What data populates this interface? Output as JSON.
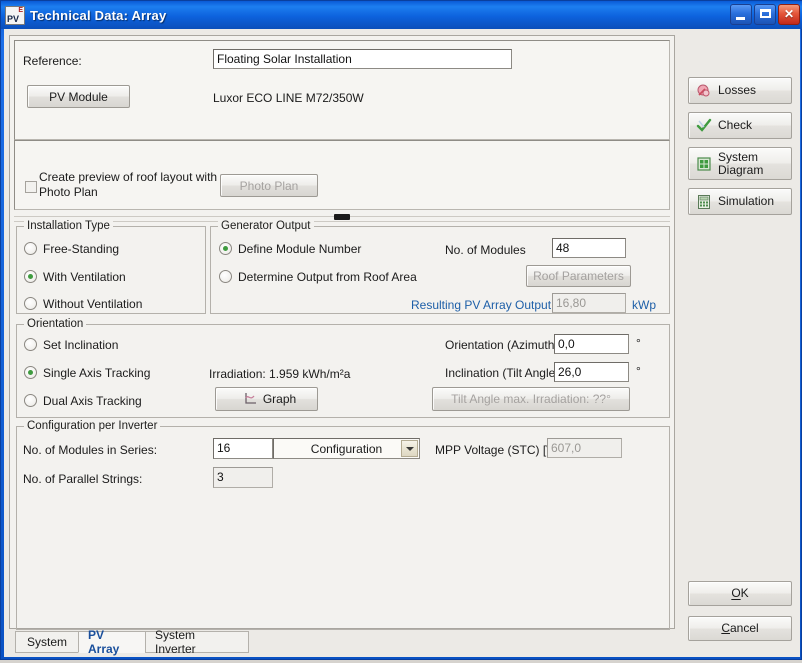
{
  "window": {
    "title": "Technical Data: Array",
    "app_icon": "pv-logo-icon",
    "minimize_label": "Minimize",
    "maximize_label": "Maximize",
    "close_label": "Close",
    "titlebar_color": "#0d62dd",
    "accent_color": "#1a4f9c"
  },
  "form": {
    "reference_label": "Reference:",
    "reference_value": "Floating Solar Installation",
    "pv_module_button": "PV Module",
    "pv_module_value": "Luxor ECO LINE M72/350W",
    "photo_plan_checkbox_label_line1": "Create preview of roof layout with",
    "photo_plan_checkbox_label_line2": "Photo Plan",
    "photo_plan_button": "Photo Plan",
    "photo_plan_checked": false,
    "photo_plan_enabled": false
  },
  "installation_type": {
    "legend": "Installation Type",
    "options": [
      {
        "label": "Free-Standing",
        "selected": false
      },
      {
        "label": "With Ventilation",
        "selected": true
      },
      {
        "label": "Without Ventilation",
        "selected": false
      }
    ]
  },
  "generator_output": {
    "legend": "Generator Output",
    "options": [
      {
        "label": "Define Module Number",
        "selected": true
      },
      {
        "label": "Determine Output from Roof Area",
        "selected": false
      }
    ],
    "modules_label": "No. of Modules",
    "modules_value": "48",
    "roof_parameters_button": "Roof Parameters",
    "roof_parameters_enabled": false,
    "result_label": "Resulting PV Array Output",
    "result_value": "16,80",
    "result_unit": "kWp"
  },
  "orientation": {
    "legend": "Orientation",
    "options": [
      {
        "label": "Set Inclination",
        "selected": false
      },
      {
        "label": "Single Axis Tracking",
        "selected": true
      },
      {
        "label": "Dual Axis Tracking",
        "selected": false
      }
    ],
    "irradiation_text": "Irradiation: 1.959 kWh/m²a",
    "graph_button": "Graph",
    "azimuth_label": "Orientation (Azimuth)",
    "azimuth_value": "0,0",
    "azimuth_unit": "°",
    "tilt_label": "Inclination (Tilt Angle)",
    "tilt_value": "26,0",
    "tilt_unit": "°",
    "tilt_max_button": "Tilt Angle max. Irradiation: ??°"
  },
  "configuration": {
    "legend": "Configuration per Inverter",
    "series_label": "No. of Modules in Series:",
    "series_value": "16",
    "combo_label": "Configuration",
    "strings_label": "No. of Parallel Strings:",
    "strings_value": "3",
    "mpp_label": "MPP Voltage (STC) [V]:",
    "mpp_value": "607,0",
    "mpp_enabled": false
  },
  "sidebar": {
    "items": [
      {
        "label": "Losses",
        "icon": "losses-icon"
      },
      {
        "label": "Check",
        "icon": "check-icon"
      },
      {
        "label": "System\nDiagram",
        "label_line1": "System",
        "label_line2": "Diagram",
        "icon": "system-diagram-icon"
      },
      {
        "label": "Simulation",
        "icon": "simulation-calculator-icon"
      }
    ],
    "ok_button": "OK",
    "ok_accel": "O",
    "cancel_button": "Cancel",
    "cancel_accel": "C"
  },
  "tabs": [
    {
      "label": "System",
      "active": false
    },
    {
      "label": "PV Array",
      "active": true
    },
    {
      "label": "System Inverter",
      "active": false
    }
  ]
}
